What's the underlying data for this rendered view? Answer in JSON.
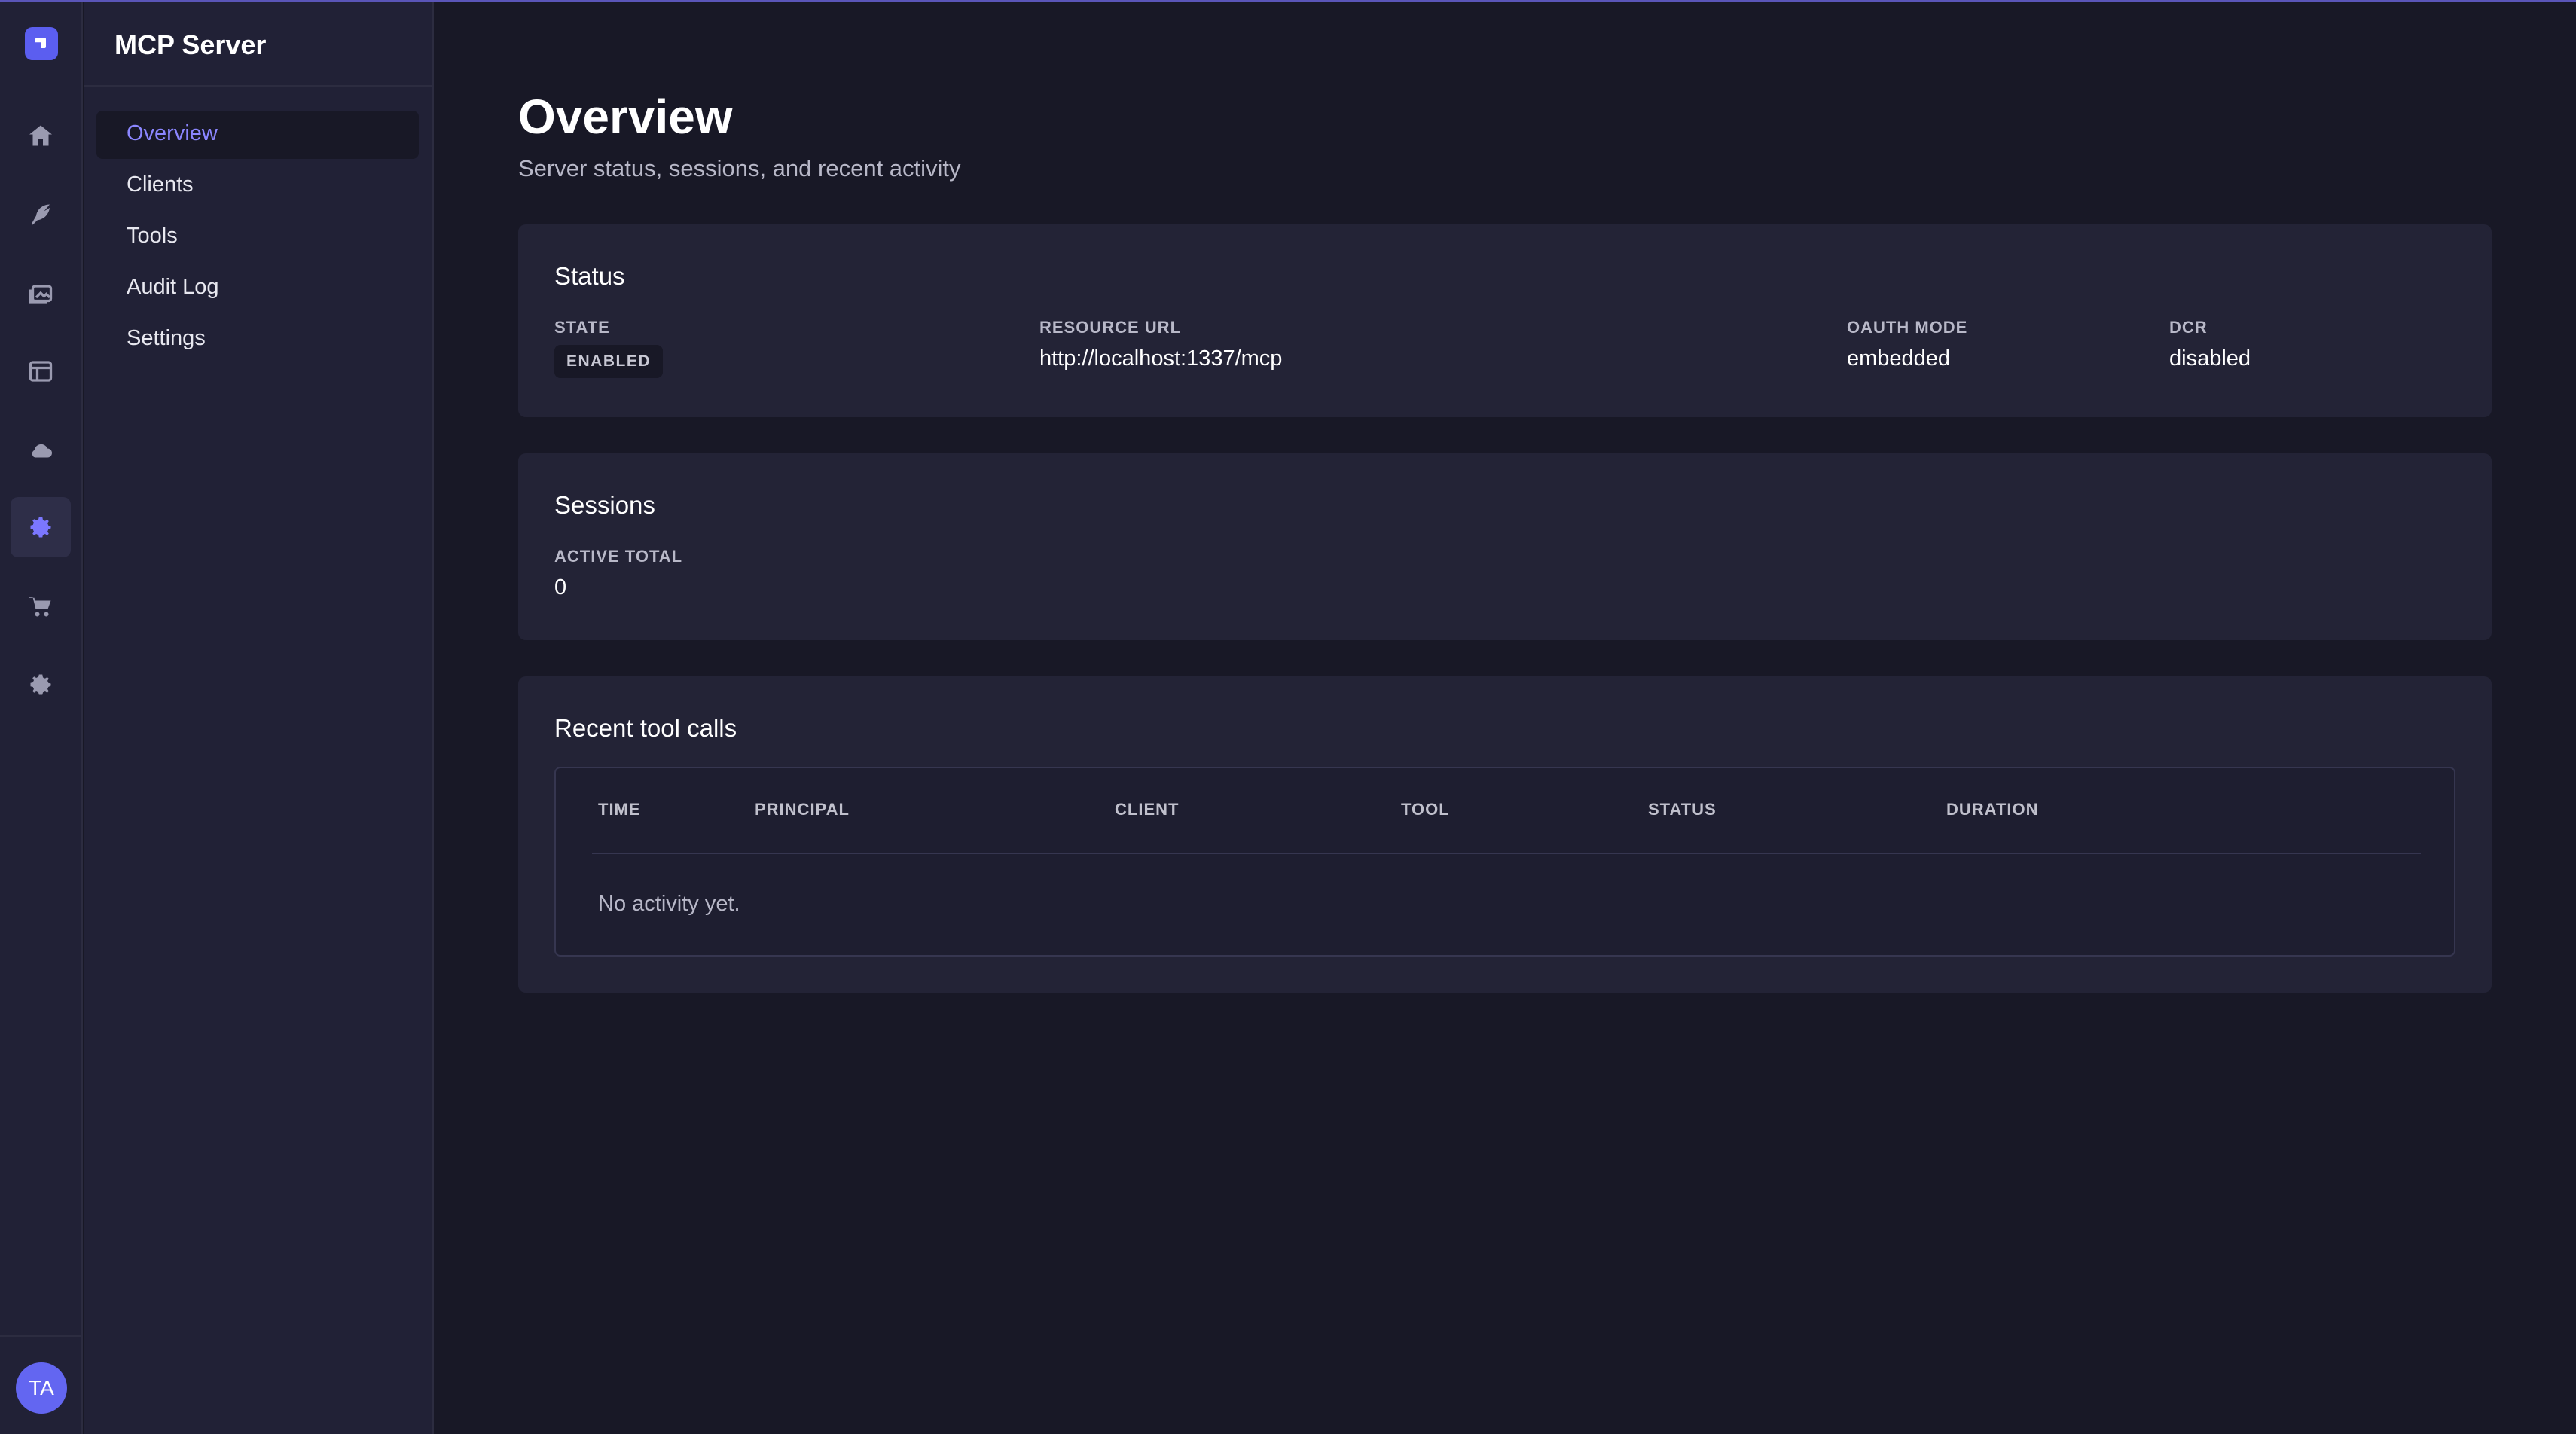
{
  "app": {
    "name": "MCP Server"
  },
  "rail": {
    "items": [
      {
        "icon": "home-icon"
      },
      {
        "icon": "feather-icon"
      },
      {
        "icon": "images-icon"
      },
      {
        "icon": "layout-icon"
      },
      {
        "icon": "cloud-icon"
      },
      {
        "icon": "gear-icon",
        "active": true
      },
      {
        "icon": "cart-icon"
      },
      {
        "icon": "settings-icon"
      }
    ],
    "avatar_initials": "TA"
  },
  "subnav": {
    "items": [
      {
        "label": "Overview",
        "active": true
      },
      {
        "label": "Clients"
      },
      {
        "label": "Tools"
      },
      {
        "label": "Audit Log"
      },
      {
        "label": "Settings"
      }
    ]
  },
  "header": {
    "title": "Overview",
    "subtitle": "Server status, sessions, and recent activity"
  },
  "status_card": {
    "title": "Status",
    "state_label": "STATE",
    "state_value": "ENABLED",
    "resource_label": "RESOURCE URL",
    "resource_value": "http://localhost:1337/mcp",
    "oauth_label": "OAUTH MODE",
    "oauth_value": "embedded",
    "dcr_label": "DCR",
    "dcr_value": "disabled"
  },
  "sessions_card": {
    "title": "Sessions",
    "active_label": "ACTIVE TOTAL",
    "active_value": "0"
  },
  "tool_calls_card": {
    "title": "Recent tool calls",
    "columns": [
      "TIME",
      "PRINCIPAL",
      "CLIENT",
      "TOOL",
      "STATUS",
      "DURATION"
    ],
    "empty_text": "No activity yet."
  },
  "colors": {
    "accent": "#8b86ff",
    "brand": "#5b5ef0",
    "background": "#181826",
    "panel": "#212136",
    "card": "#232336"
  }
}
